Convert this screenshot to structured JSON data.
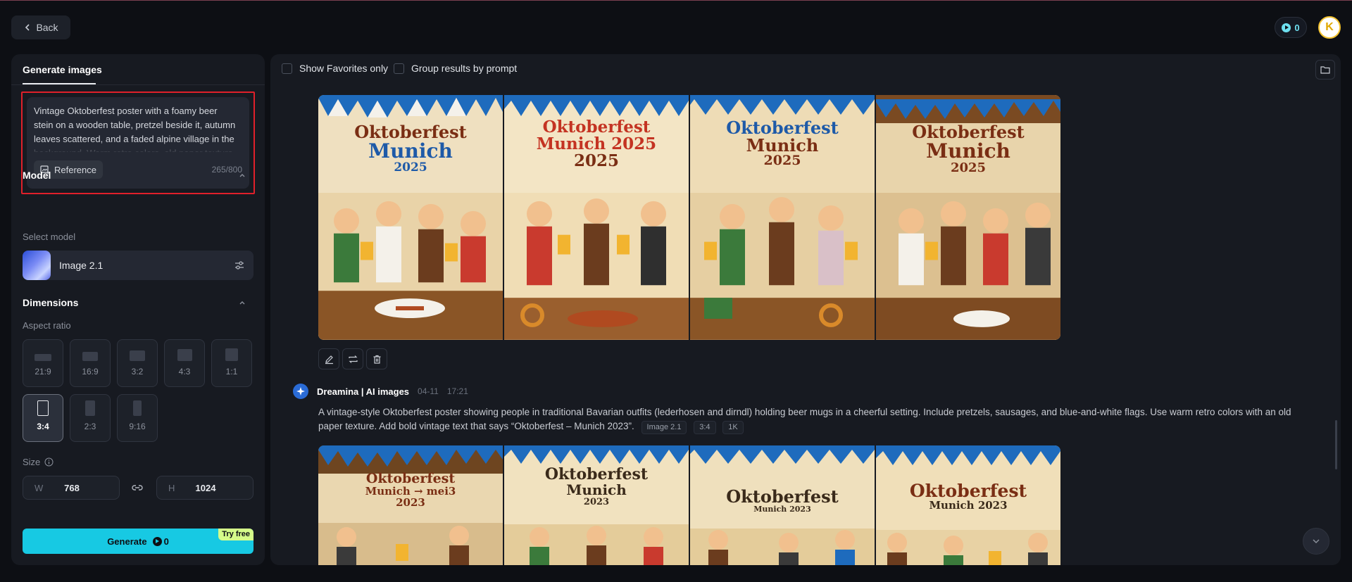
{
  "header": {
    "back_label": "Back",
    "credits": "0",
    "avatar_letter": "K"
  },
  "left_panel": {
    "tab_label": "Generate images",
    "prompt_text": "Vintage Oktoberfest poster with a foamy beer stein on a wooden table, pretzel beside it, autumn leaves scattered, and a faded alpine village in the background. Warm retro colors, old paper texture.",
    "reference_label": "Reference",
    "char_count": "265/800",
    "model": {
      "section_label": "Model",
      "select_label": "Select model",
      "selected": "Image 2.1"
    },
    "dimensions": {
      "section_label": "Dimensions",
      "aspect_label": "Aspect ratio",
      "ratios": [
        "21:9",
        "16:9",
        "3:2",
        "4:3",
        "1:1",
        "3:4",
        "2:3",
        "9:16"
      ],
      "selected_ratio": "3:4",
      "size_label": "Size",
      "width_key": "W",
      "width": "768",
      "height_key": "H",
      "height": "1024"
    },
    "generate": {
      "label": "Generate",
      "cost": "0",
      "badge": "Try free"
    }
  },
  "main": {
    "show_favorites_label": "Show Favorites only",
    "group_results_label": "Group results by prompt",
    "batch1": {
      "images": [
        {
          "line1": "Oktoberfest",
          "line2": "Munich",
          "line3": "2025"
        },
        {
          "line1": "Oktoberfest",
          "line2": "Munich 2025",
          "line3": "2025"
        },
        {
          "line1": "Oktoberfest",
          "line2": "Munich",
          "line3": "2025"
        },
        {
          "line1": "Oktoberfest",
          "line2": "Munich",
          "line3": "2025"
        }
      ]
    },
    "batch2": {
      "author": "Dreamina | AI images",
      "date": "04-11",
      "time": "17:21",
      "prompt": "A vintage-style Oktoberfest poster showing people in traditional Bavarian outfits (lederhosen and dirndl) holding beer mugs in a cheerful setting. Include pretzels, sausages, and blue-and-white flags. Use warm retro colors with an old paper texture. Add bold vintage text that says “Oktoberfest – Munich 2023”.",
      "tags": [
        "Image 2.1",
        "3:4",
        "1K"
      ],
      "images": [
        {
          "line1": "Oktoberfest",
          "line2": "Munich → mei3",
          "line3": "2023"
        },
        {
          "line1": "Oktoberfest",
          "line2": "Munich",
          "line3": "2023"
        },
        {
          "line1": "Oktoberfest",
          "line2": "Munich 2023",
          "line3": ""
        },
        {
          "line1": "Oktoberfest",
          "line2": "Munich 2023",
          "line3": ""
        }
      ]
    }
  },
  "colors": {
    "accent": "#17c9e3",
    "badge": "#d5fb8a",
    "highlight_border": "#e0202a"
  }
}
